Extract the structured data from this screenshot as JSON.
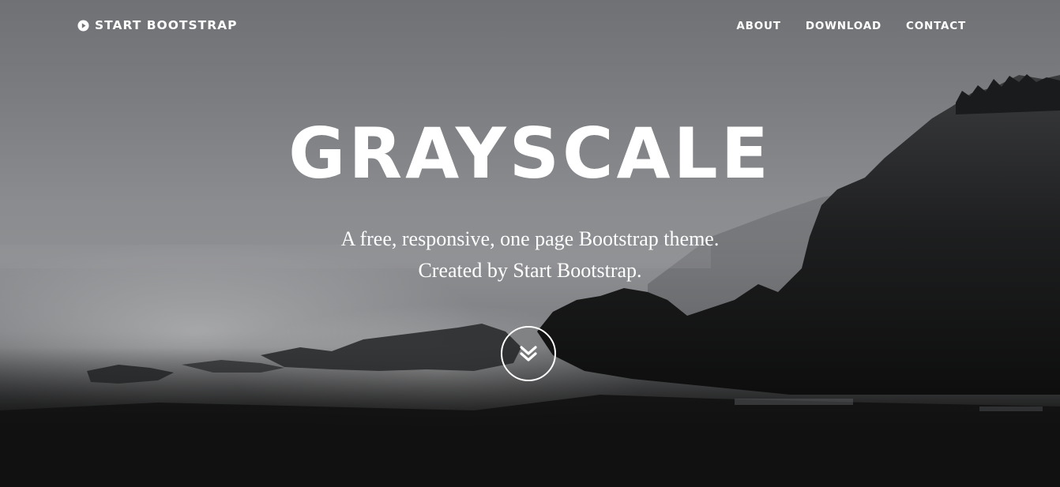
{
  "navbar": {
    "brand": {
      "icon": "play-circle-icon",
      "label": "START BOOTSTRAP"
    },
    "links": [
      {
        "label": "ABOUT"
      },
      {
        "label": "DOWNLOAD"
      },
      {
        "label": "CONTACT"
      }
    ]
  },
  "hero": {
    "title": "GRAYSCALE",
    "subtitle_line1": "A free, responsive, one page Bootstrap theme.",
    "subtitle_line2": "Created by Start Bootstrap.",
    "scroll_button": {
      "icon": "double-chevron-down-icon"
    }
  },
  "colors": {
    "text": "#ffffff",
    "page_bottom": "#0b0b0b"
  }
}
